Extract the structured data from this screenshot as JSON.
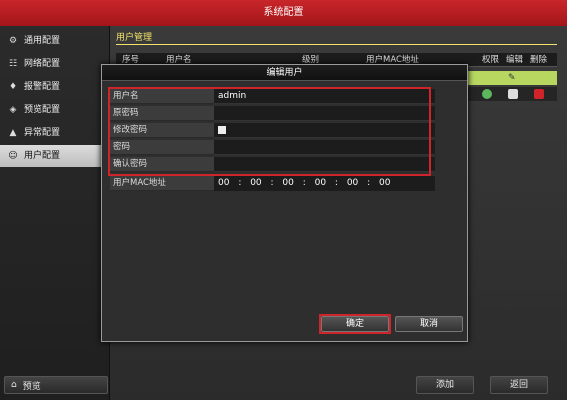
{
  "window": {
    "title": "系统配置"
  },
  "sidebar": {
    "items": [
      {
        "label": "通用配置",
        "icon": "gear-icon"
      },
      {
        "label": "网络配置",
        "icon": "network-icon"
      },
      {
        "label": "报警配置",
        "icon": "alarm-icon"
      },
      {
        "label": "预览配置",
        "icon": "eye-icon"
      },
      {
        "label": "异常配置",
        "icon": "warning-icon"
      },
      {
        "label": "用户配置",
        "icon": "user-icon",
        "active": true
      }
    ],
    "preview_button": "预览"
  },
  "main": {
    "section_title": "用户管理",
    "table_headers": [
      "序号",
      "用户名",
      "级别",
      "用户MAC地址",
      "权限",
      "编辑",
      "删除"
    ],
    "buttons": {
      "add": "添加",
      "back": "返回"
    }
  },
  "dialog": {
    "title": "编辑用户",
    "fields": [
      {
        "label": "用户名",
        "value": "admin"
      },
      {
        "label": "原密码",
        "value": ""
      },
      {
        "label": "修改密码",
        "value": ""
      },
      {
        "label": "密码",
        "value": ""
      },
      {
        "label": "确认密码",
        "value": ""
      }
    ],
    "mac_label": "用户MAC地址",
    "mac_value": "00 : 00 : 00 : 00 : 00 : 00",
    "confirm": "确定",
    "cancel": "取消"
  },
  "colors": {
    "accent": "#d0242b",
    "selected_row": "#b7d760",
    "section_title": "#f3e36b"
  }
}
